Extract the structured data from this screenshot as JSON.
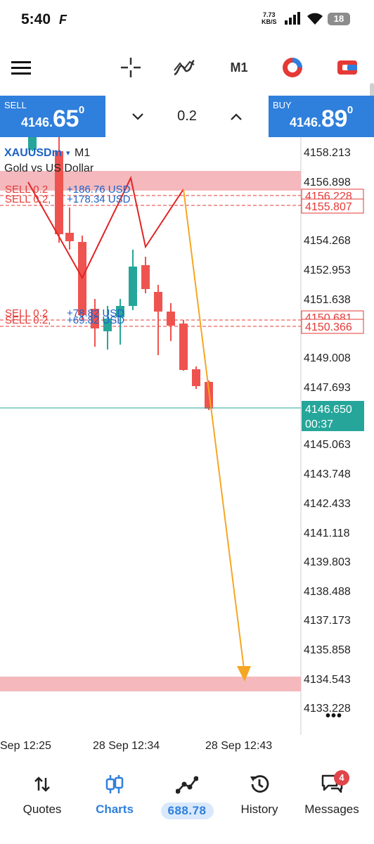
{
  "status_bar": {
    "time": "5:40",
    "net_speed_value": "7.73",
    "net_speed_unit": "KB/S",
    "battery": "18"
  },
  "toolbar": {
    "timeframe": "M1",
    "icons": [
      "menu-icon",
      "crosshair-icon",
      "indicators-icon",
      "trade-toggle-icon",
      "account-icon"
    ]
  },
  "trade_bar": {
    "sell_label": "SELL",
    "sell_price_small": "4146.",
    "sell_price_big": "65",
    "sell_price_sup": "0",
    "buy_label": "BUY",
    "buy_price_small": "4146.",
    "buy_price_big": "89",
    "buy_price_sup": "0",
    "lot": "0.2"
  },
  "chart": {
    "symbol": "XAUUSDm",
    "timeframe": "M1",
    "description": "Gold vs US Dollar",
    "current_price": "4146.650",
    "countdown": "00:37",
    "price_axis": [
      "4158.213",
      "4156.898",
      "4154.268",
      "4152.953",
      "4151.638",
      "4149.008",
      "4147.693",
      "4145.063",
      "4143.748",
      "4142.433",
      "4141.118",
      "4139.803",
      "4138.488",
      "4137.173",
      "4135.858",
      "4134.543",
      "4133.228"
    ],
    "time_axis": [
      "Sep 12:25",
      "28 Sep 12:34",
      "28 Sep 12:43"
    ],
    "positions": [
      {
        "label": "SELL 0.2",
        "profit": "+186.76 USD",
        "price_tag": "4156.228"
      },
      {
        "label": "SELL 0.2,",
        "profit": "+178.34 USD",
        "price_tag": "4155.807"
      },
      {
        "label": "SELL 0.2",
        "profit": "+78.82 USD",
        "price_tag": "4150.681"
      },
      {
        "label": "SELL 0.2,",
        "profit": "+69.82 USD",
        "price_tag": "4150.366"
      }
    ],
    "colors": {
      "bull": "#26a69a",
      "bear": "#ef5350",
      "zone": "#f4b8bd",
      "arrow": "#f5a623",
      "drawing": "#e02424",
      "bid_line": "#26a69a",
      "accent": "#2f7fdc"
    },
    "more_icon": "more-dots-icon"
  },
  "bottom_nav": {
    "items": [
      {
        "label": "Quotes",
        "icon": "quotes-icon"
      },
      {
        "label": "Charts",
        "icon": "charts-icon"
      },
      {
        "label": "688.78",
        "icon": "trade-icon"
      },
      {
        "label": "History",
        "icon": "history-icon"
      },
      {
        "label": "Messages",
        "icon": "messages-icon",
        "badge": "4"
      }
    ]
  }
}
